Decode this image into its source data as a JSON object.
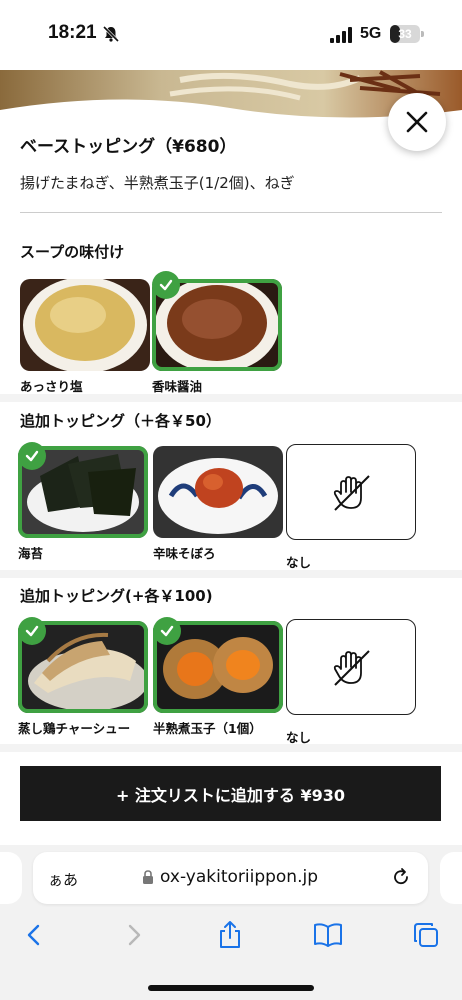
{
  "status_bar": {
    "time": "18:21",
    "network": "5G",
    "battery_level": "33",
    "battery_percent": 33
  },
  "modal": {
    "base_title": "ベーストッピング（¥680）",
    "base_desc": "揚げたまねぎ、半熟煮玉子(1/2個)、ねぎ"
  },
  "sections": [
    {
      "title": "スープの味付け",
      "options": [
        {
          "label": "あっさり塩",
          "selected": false,
          "icon": "salt-soup-photo"
        },
        {
          "label": "香味醤油",
          "selected": true,
          "icon": "soy-soup-photo"
        }
      ]
    },
    {
      "title": "追加トッピング（＋各￥50）",
      "options": [
        {
          "label": "海苔",
          "selected": true,
          "icon": "nori-photo"
        },
        {
          "label": "辛味そぼろ",
          "selected": false,
          "icon": "spicy-minced-photo"
        },
        {
          "label": "なし",
          "selected": false,
          "icon": "no-hand-icon"
        }
      ]
    },
    {
      "title": "追加トッピング(+各￥100)",
      "options": [
        {
          "label": "蒸し鶏チャーシュー",
          "selected": true,
          "icon": "chicken-chashu-photo"
        },
        {
          "label": "半熟煮玉子（1個）",
          "selected": true,
          "icon": "egg-photo"
        },
        {
          "label": "なし",
          "selected": false,
          "icon": "no-hand-icon"
        }
      ]
    }
  ],
  "add_button_label": "+ 注文リストに追加する ¥930",
  "browser": {
    "aa": "ぁあ",
    "url": "ox-yakitoriippon.jp"
  },
  "colors": {
    "accent_green": "#3fa142",
    "button_black": "#1a1a1a",
    "ios_blue": "#1a73e8"
  }
}
